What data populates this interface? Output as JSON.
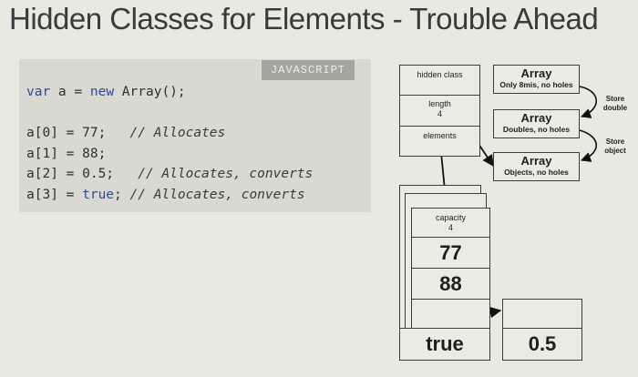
{
  "title": "Hidden Classes for Elements - Trouble Ahead",
  "code_panel": {
    "language_tag": "JAVASCRIPT",
    "lines": [
      "var a = new Array();",
      "",
      "a[0] = 77;   // Allocates",
      "a[1] = 88;",
      "a[2] = 0.5;   // Allocates, converts",
      "a[3] = true; // Allocates, converts"
    ]
  },
  "diagram": {
    "object": {
      "hidden_class": "hidden class",
      "length_label": "length",
      "length_value": "4",
      "elements_label": "elements"
    },
    "array_kinds": [
      {
        "title": "Array",
        "subtitle": "Only 8mis, no holes"
      },
      {
        "title": "Array",
        "subtitle": "Doubles, no holes"
      },
      {
        "title": "Array",
        "subtitle": "Objects, no holes"
      }
    ],
    "transitions": [
      {
        "label_line1": "Store",
        "label_line2": "double"
      },
      {
        "label_line1": "Store",
        "label_line2": "object"
      }
    ],
    "backing_store": {
      "capacity_label": "capacity",
      "capacity_value": "4",
      "cells": [
        "77",
        "88",
        "",
        "true"
      ]
    },
    "boxed_value": "0.5"
  }
}
